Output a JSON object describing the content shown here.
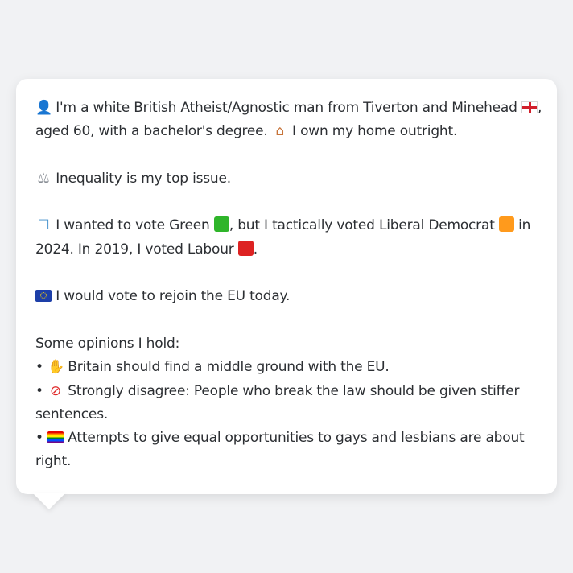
{
  "card": {
    "intro_line1": "I'm a white British Atheist/Agnostic man from Tiverton and Minehead",
    "intro_line1_end": ",",
    "intro_line2": "aged 60, with a bachelor's degree.",
    "intro_line2_home": "I own my home outright.",
    "issue": "Inequality is my top issue.",
    "vote_line1_a": "I wanted to vote Green",
    "vote_line1_b": ", but I tactically voted Liberal Democrat",
    "vote_line1_c": "in",
    "vote_line2_a": "2024. In 2019, I voted Labour",
    "vote_line2_b": ".",
    "eu": "I would vote to rejoin the EU today.",
    "opinions_heading": "Some opinions I hold:",
    "bullet": "•",
    "opinion1": "Britain should find a middle ground with the EU.",
    "opinion2_line1": "Strongly disagree: People who break the law should be given stiffer",
    "opinion2_line2": "sentences.",
    "opinion3_line1": "Attempts to give equal opportunities to gays and lesbians are about",
    "opinion3_line2": "right."
  },
  "icons": {
    "person": "person-icon",
    "england_flag": "england-flag-icon",
    "house": "house-icon",
    "scales": "scales-icon",
    "ballot_box": "ballot-box-icon",
    "green_square": "green-square-icon",
    "orange_square": "orange-square-icon",
    "red_square": "red-square-icon",
    "eu_flag": "eu-flag-icon",
    "handshake": "handshake-icon",
    "no_entry": "no-entry-icon",
    "rainbow_flag": "rainbow-flag-icon"
  },
  "colors": {
    "background": "#f1f2f4",
    "card": "#ffffff",
    "text": "#2c2f33",
    "green": "#2fb52a",
    "orange": "#ff9a1c",
    "red": "#dd2222"
  }
}
